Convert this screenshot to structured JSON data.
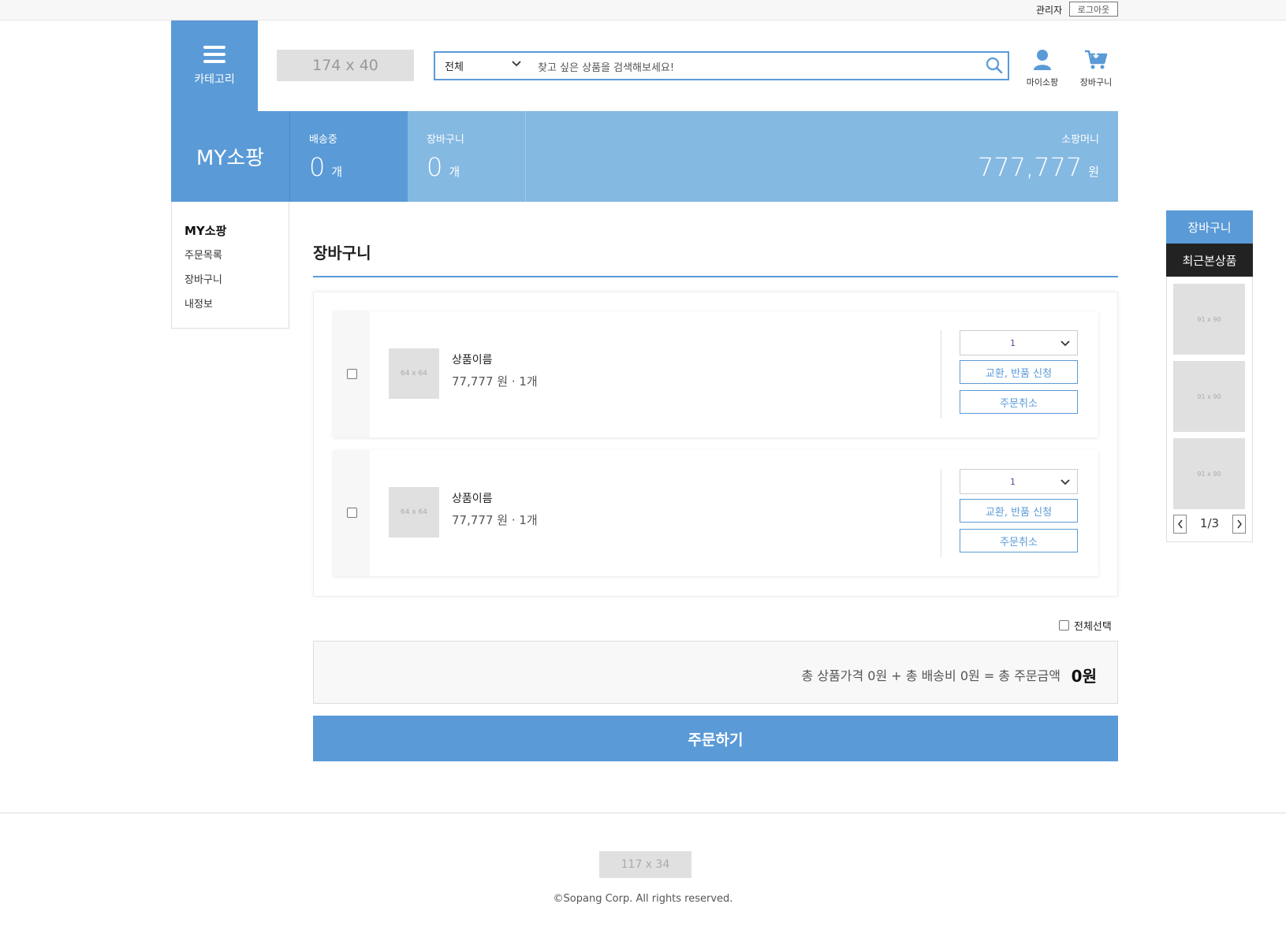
{
  "topbar": {
    "admin_label": "관리자",
    "logout_label": "로그아웃"
  },
  "header": {
    "category_label": "카테고리",
    "logo_placeholder": "174 x 40",
    "search": {
      "category_value": "전체",
      "placeholder": "찾고 싶은 상품을 검색해보세요!"
    },
    "mypage_label": "마이소팡",
    "cart_label": "장바구니"
  },
  "summary": {
    "title": "MY소팡",
    "shipping": {
      "label": "배송중",
      "value": "0",
      "unit": "개"
    },
    "cart": {
      "label": "장바구니",
      "value": "0",
      "unit": "개"
    },
    "money": {
      "label": "소팡머니",
      "value": "777,777",
      "unit": "원"
    }
  },
  "sidebar": {
    "title": "MY소팡",
    "items": [
      {
        "label": "주문목록"
      },
      {
        "label": "장바구니"
      },
      {
        "label": "내정보"
      }
    ]
  },
  "main": {
    "title": "장바구니",
    "items": [
      {
        "thumb": "64 x 64",
        "name": "상품이름",
        "price": "77,777 원 · 1개",
        "qty": "1",
        "exchange_label": "교환, 반품 신청",
        "cancel_label": "주문취소"
      },
      {
        "thumb": "64 x 64",
        "name": "상품이름",
        "price": "77,777 원 · 1개",
        "qty": "1",
        "exchange_label": "교환, 반품 신청",
        "cancel_label": "주문취소"
      }
    ],
    "select_all_label": "전체선택",
    "total_text": "총 상품가격 0원 + 총 배송비 0원 = 총 주문금액",
    "total_sum": "0원",
    "order_button": "주문하기"
  },
  "right_panel": {
    "cart_label": "장바구니",
    "recent_label": "최근본상품",
    "items": [
      {
        "label": "91 x 90"
      },
      {
        "label": "91 x 90"
      },
      {
        "label": "91 x 90"
      }
    ],
    "page": "1/3"
  },
  "footer": {
    "logo_placeholder": "117 x 34",
    "copyright": "©Sopang Corp. All rights reserved."
  },
  "colors": {
    "primary": "#5a9ad7",
    "light_primary": "#84b9e2",
    "dark": "#222222"
  }
}
